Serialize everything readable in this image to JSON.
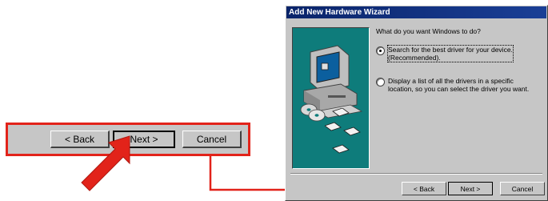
{
  "zoom_bar": {
    "back_label": "< Back",
    "next_label": "Next >",
    "cancel_label": "Cancel"
  },
  "dialog": {
    "title": "Add New Hardware Wizard",
    "question": "What do you want Windows to do?",
    "options": [
      {
        "line1": "Search for the best driver for your device.",
        "line2": "(Recommended).",
        "selected": true
      },
      {
        "line1": "Display a list of all the drivers in a specific",
        "line2": "location, so you can select the driver you want.",
        "selected": false
      }
    ],
    "buttons": {
      "back_label": "< Back",
      "next_label": "Next >",
      "cancel_label": "Cancel"
    }
  },
  "colors": {
    "highlight_red": "#e2231a",
    "dialog_gray": "#c6c6c6",
    "titlebar_blue": "#0a246a",
    "art_teal": "#0e7c7b"
  },
  "icons": {
    "arrow": "red-pointer-arrow",
    "computer": "computer-icon",
    "discs": "cd-disc-icon",
    "floppies": "floppy-disk-icon"
  }
}
